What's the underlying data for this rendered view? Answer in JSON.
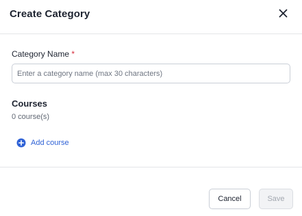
{
  "dialog": {
    "title": "Create Category",
    "close_icon": "close-icon"
  },
  "form": {
    "name_label": "Category Name",
    "required_marker": "*",
    "name_value": "",
    "name_placeholder": "Enter a category name (max 30 characters)"
  },
  "courses": {
    "heading": "Courses",
    "count_text": "0 course(s)",
    "add_label": "Add course",
    "add_icon": "plus-circle-icon"
  },
  "footer": {
    "cancel_label": "Cancel",
    "save_label": "Save",
    "save_disabled": true
  },
  "colors": {
    "accent": "#2f62d6",
    "required": "#d62d3c",
    "text": "#1d2330",
    "disabled_text": "#a3a8b0"
  }
}
